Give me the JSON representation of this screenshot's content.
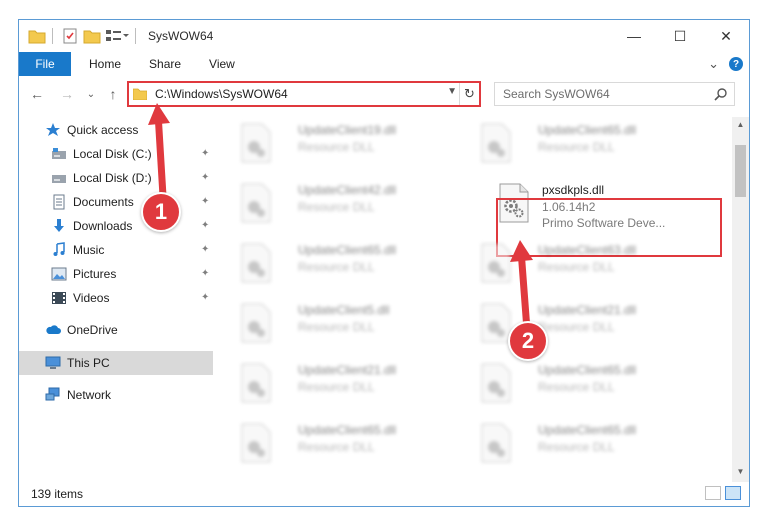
{
  "window": {
    "title": "SysWOW64",
    "controls": {
      "minimize": "—",
      "maximize": "☐",
      "close": "✕"
    }
  },
  "ribbon": {
    "tabs": [
      "File",
      "Home",
      "Share",
      "View"
    ],
    "expand": "⌄",
    "help": "?"
  },
  "navigation": {
    "back": "←",
    "forward": "→",
    "recent": "⌄",
    "up": "↑",
    "address": "C:\\Windows\\SysWOW64",
    "refresh": "↻",
    "search_placeholder": "Search SysWOW64"
  },
  "sidebar": {
    "items": [
      {
        "label": "Quick access",
        "icon": "star-icon",
        "pinned": false
      },
      {
        "label": "Local Disk (C:)",
        "icon": "drive-icon",
        "pinned": true
      },
      {
        "label": "Local Disk (D:)",
        "icon": "drive-icon",
        "pinned": true
      },
      {
        "label": "Documents",
        "icon": "documents-icon",
        "pinned": true
      },
      {
        "label": "Downloads",
        "icon": "download-icon",
        "pinned": true
      },
      {
        "label": "Music",
        "icon": "music-icon",
        "pinned": true
      },
      {
        "label": "Pictures",
        "icon": "pictures-icon",
        "pinned": true
      },
      {
        "label": "Videos",
        "icon": "videos-icon",
        "pinned": true
      },
      {
        "label": "OneDrive",
        "icon": "cloud-icon",
        "pinned": false
      },
      {
        "label": "This PC",
        "icon": "computer-icon",
        "pinned": false,
        "selected": true
      },
      {
        "label": "Network",
        "icon": "network-icon",
        "pinned": false
      }
    ],
    "pin_glyph": "📌"
  },
  "files": {
    "left_column": [
      {
        "name": "UpdateClient19.dll",
        "type": "Resource DLL"
      },
      {
        "name": "UpdateClient42.dll",
        "type": "Resource DLL"
      },
      {
        "name": "UpdateClient65.dll",
        "type": "Resource DLL"
      },
      {
        "name": "UpdateClient5.dll",
        "type": "Resource DLL"
      },
      {
        "name": "UpdateClient21.dll",
        "type": "Resource DLL"
      },
      {
        "name": "UpdateClient65.dll",
        "type": "Resource DLL"
      }
    ],
    "right_column": [
      {
        "name": "UpdateClient65.dll",
        "type": "Resource DLL"
      },
      {
        "name": "pxsdkpls.dll",
        "version": "1.06.14h2",
        "company": "Primo Software Deve...",
        "highlighted": true
      },
      {
        "name": "UpdateClient63.dll",
        "type": "Resource DLL"
      },
      {
        "name": "UpdateClient21.dll",
        "type": "Resource DLL"
      },
      {
        "name": "UpdateClient65.dll",
        "type": "Resource DLL"
      },
      {
        "name": "UpdateClient65.dll",
        "type": "Resource DLL"
      }
    ]
  },
  "status": {
    "item_count": "139 items"
  },
  "callouts": {
    "one": "1",
    "two": "2"
  },
  "colors": {
    "accent": "#1979ca",
    "highlight": "#e0393e"
  }
}
